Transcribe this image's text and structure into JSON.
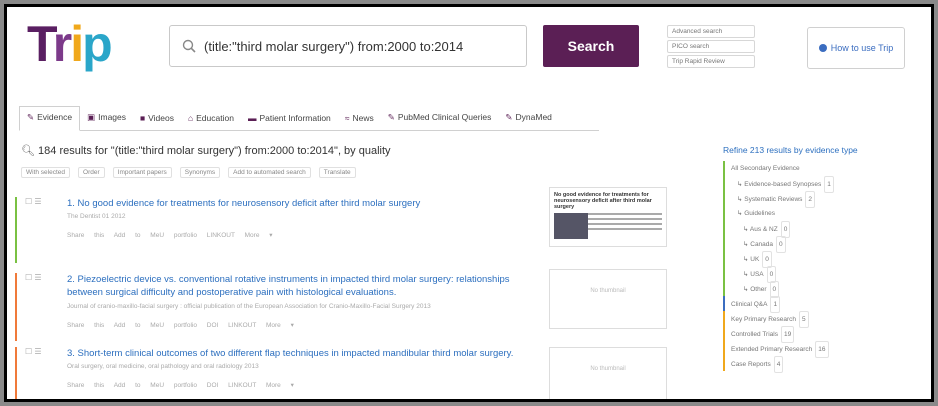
{
  "logo": {
    "t": "T",
    "r": "r",
    "i": "i",
    "p": "p"
  },
  "search": {
    "query": "(title:\"third molar surgery\") from:2000 to:2014",
    "button": "Search"
  },
  "mini_links": [
    "Advanced search",
    "PICO search",
    "Trip Rapid Review"
  ],
  "how_to": "How to use Trip",
  "tabs": [
    {
      "icon": "✎",
      "label": "Evidence"
    },
    {
      "icon": "▣",
      "label": "Images"
    },
    {
      "icon": "■",
      "label": "Videos"
    },
    {
      "icon": "⌂",
      "label": "Education"
    },
    {
      "icon": "▬",
      "label": "Patient Information"
    },
    {
      "icon": "≈",
      "label": "News"
    },
    {
      "icon": "✎",
      "label": "PubMed Clinical Queries"
    },
    {
      "icon": "✎",
      "label": "DynaMed"
    }
  ],
  "results_title": "184 results for \"(title:\"third molar surgery\") from:2000 to:2014\", by quality",
  "toolbar": [
    "With selected",
    "Order",
    "Important papers",
    "Synonyms",
    "Add to automated search",
    "Translate"
  ],
  "results": [
    {
      "color": "#7ac143",
      "title": "1. No good evidence for treatments for neurosensory deficit after third molar surgery",
      "source": "The Dentist 01  2012",
      "actions": "Share this   Add to MeU portfolio   LINKOUT   More ▾"
    },
    {
      "color": "#f07a3a",
      "title": "2. Piezoelectric device vs. conventional rotative instruments in impacted third molar surgery: relationships between surgical difficulty and postoperative pain with histological evaluations.",
      "source": "Journal of cranio-maxillo-facial surgery : official publication of the European Association for Cranio-Maxillo-Facial Surgery  2013",
      "actions": "Share this   Add to MeU portfolio   DOI   LINKOUT   More ▾"
    },
    {
      "color": "#f07a3a",
      "title": "3. Short-term clinical outcomes of two different flap techniques in impacted mandibular third molar surgery.",
      "source": "Oral surgery, oral medicine, oral pathology and oral radiology  2013",
      "actions": "Share this   Add to MeU portfolio   DOI   LINKOUT   More ▾"
    }
  ],
  "thumb_placeholder": "No thumbnail",
  "thumb1": {
    "title": "No good evidence for treatments for neurosensory deficit after third molar surgery"
  },
  "refine": {
    "head": "Refine 213 results by evidence type",
    "items": [
      {
        "label": "All Secondary Evidence",
        "count": ""
      },
      {
        "label": "↳ Evidence-based Synopses",
        "count": "1"
      },
      {
        "label": "↳ Systematic Reviews",
        "count": "2"
      },
      {
        "label": "↳ Guidelines",
        "count": ""
      },
      {
        "label": "↳ Aus & NZ",
        "count": "0"
      },
      {
        "label": "↳ Canada",
        "count": "0"
      },
      {
        "label": "↳ UK",
        "count": "0"
      },
      {
        "label": "↳ USA",
        "count": "0"
      },
      {
        "label": "↳ Other",
        "count": "0"
      },
      {
        "label": "Clinical Q&A",
        "count": "1"
      },
      {
        "label": "Key Primary Research",
        "count": "5"
      },
      {
        "label": "Controlled Trials",
        "count": "19"
      },
      {
        "label": "Extended Primary Research",
        "count": "16"
      },
      {
        "label": "Case Reports",
        "count": "4"
      }
    ]
  }
}
